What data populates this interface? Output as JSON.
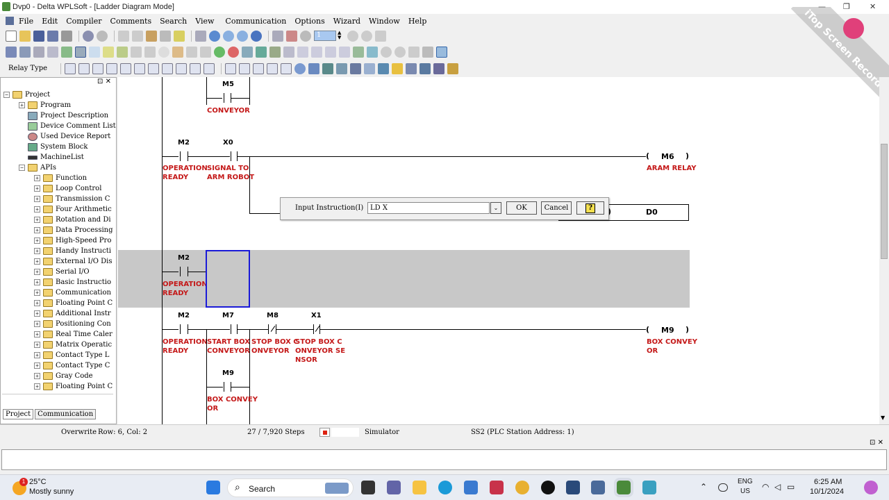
{
  "window": {
    "title": "Dvp0 - Delta WPLSoft - [Ladder Diagram Mode]",
    "controls": {
      "minimize": "—",
      "maximize": "❐",
      "close": "✕"
    }
  },
  "menu": [
    "File",
    "Edit",
    "Compiler",
    "Comments",
    "Search",
    "View",
    "Communication",
    "Options",
    "Wizard",
    "Window",
    "Help"
  ],
  "toolbar": {
    "relay_type_label": "Relay Type",
    "step_value": "1"
  },
  "project_tree": {
    "root": "Project",
    "items": [
      "Program",
      "Project Description",
      "Device Comment List",
      "Used Device Report",
      "System Block",
      "MachineList",
      "APIs"
    ],
    "api_items": [
      "Function",
      "Loop Control",
      "Transmission C",
      "Four Arithmetic",
      "Rotation and Di",
      "Data Processing",
      "High-Speed Pro",
      "Handy Instructi",
      "External I/O Dis",
      "Serial I/O",
      "Basic Instructio",
      "Communication",
      "Floating Point C",
      "Additional Instr",
      "Positioning Con",
      "Real Time Caler",
      "Matrix Operatic",
      "Contact Type L",
      "Contact Type C",
      "Gray Code",
      "Floating Point C"
    ],
    "tabs": [
      "Project",
      "Communication"
    ],
    "header_buttons": [
      "⊡",
      "✕"
    ]
  },
  "ladder": {
    "rung0": {
      "contact": "M5",
      "comment": "CONVEYOR"
    },
    "rung1": {
      "c1": "M2",
      "c1_comment": [
        "OPERATION",
        "READY"
      ],
      "c2": "X0",
      "c2_comment": [
        "SIGNAL TO",
        "ARM ROBOT"
      ],
      "coil": "M6",
      "coil_comment": "ARAM RELAY",
      "inst_d": "D0",
      "inst_partial": ")"
    },
    "rung2": {
      "c1": "M2",
      "c1_comment": [
        "OPERATION",
        "READY"
      ]
    },
    "rung3": {
      "c1": "M2",
      "c1_comment": [
        "OPERATION",
        "READY"
      ],
      "c2": "M7",
      "c2_comment": [
        "START BOX",
        "CONVEYOR"
      ],
      "c3": "M8",
      "c3_comment": [
        "STOP BOX C",
        "ONVEYOR"
      ],
      "c4": "X1",
      "c4_comment": [
        "STOP BOX C",
        "ONVEYOR SE",
        "NSOR"
      ],
      "branch": "M9",
      "branch_comment": [
        "BOX CONVEY",
        "OR"
      ],
      "coil": "M9",
      "coil_comment": [
        "BOX CONVEY",
        "OR"
      ]
    }
  },
  "dialog": {
    "label": "Input Instruction(I)",
    "value": "LD X",
    "ok": "OK",
    "cancel": "Cancel",
    "help": "?"
  },
  "status": {
    "mode": "Overwrite",
    "pos": "Row: 6, Col: 2",
    "steps": "27 / 7,920 Steps",
    "sim": "Simulator",
    "station": "SS2 (PLC Station Address: 1)"
  },
  "output_panel_buttons": [
    "⊡",
    "✕"
  ],
  "watermark": "iTop Screen Recorder",
  "taskbar": {
    "weather_temp": "25°C",
    "weather_desc": "Mostly sunny",
    "weather_badge": "1",
    "search": "Search",
    "lang1": "ENG",
    "lang2": "US",
    "time": "6:25 AM",
    "date": "10/1/2024"
  },
  "colors": {
    "comment": "#c41818",
    "selection": "#1a1ad8",
    "highlight_band": "#c8c8c8"
  }
}
